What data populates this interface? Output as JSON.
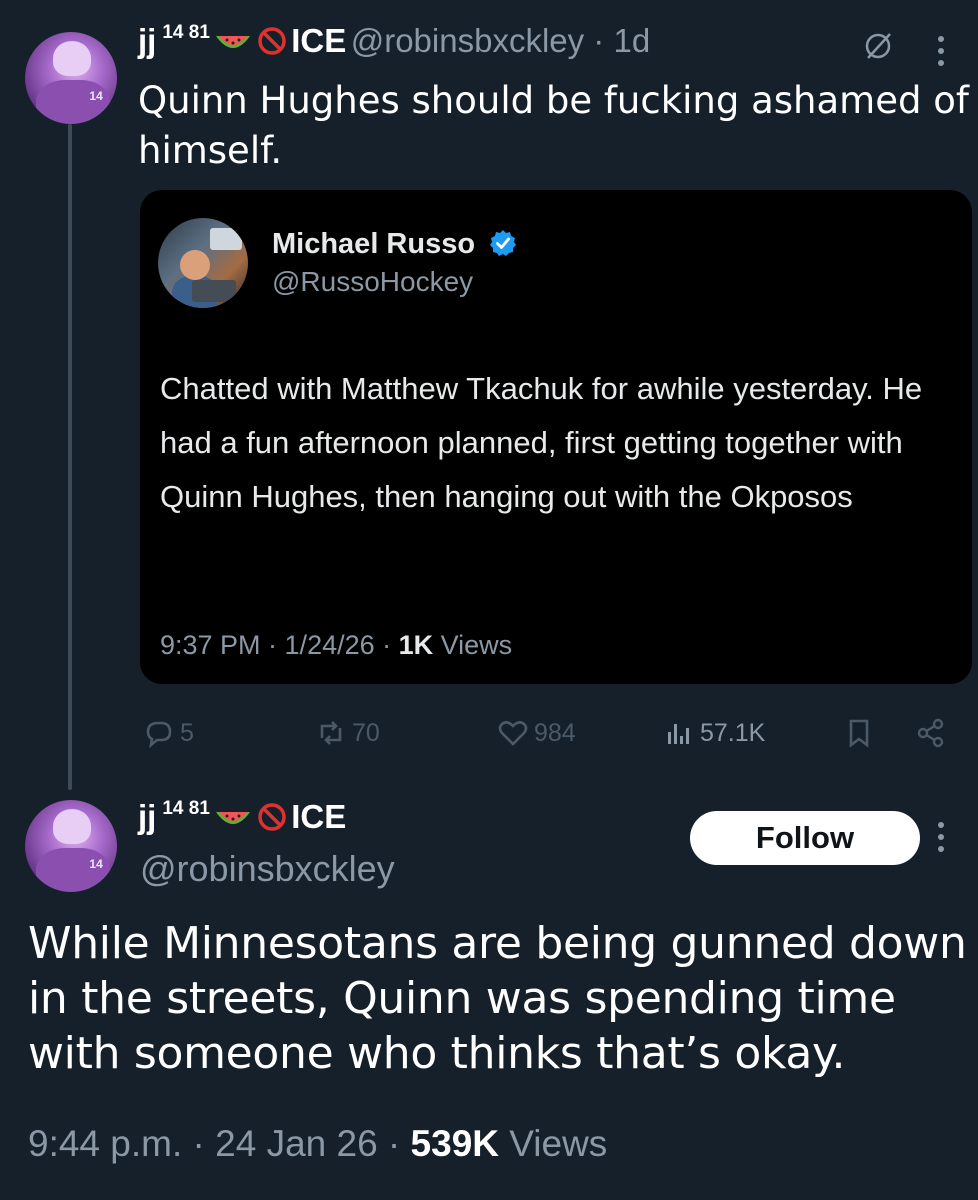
{
  "reply_tweet": {
    "display_name": "jj",
    "name_sup": "14 81",
    "ice_label": "ICE",
    "handle": "@robinsbxckley",
    "time": "1d",
    "text": "Quinn Hughes should be fucking ashamed of himself."
  },
  "quoted_tweet": {
    "name": "Michael Russo",
    "handle": "@RussoHockey",
    "text": "Chatted with Matthew Tkachuk for awhile yesterday. He had a fun afternoon planned, first getting together with Quinn Hughes, then hanging out with the Okposos",
    "time": "9:37 PM · 1/24/26 · ",
    "views_count": "1K",
    "views_label": " Views"
  },
  "actions": {
    "replies": "5",
    "retweets": "70",
    "likes": "984",
    "views": "57.1K"
  },
  "main_tweet": {
    "display_name": "jj",
    "name_sup": "14 81",
    "ice_label": "ICE",
    "handle": "@robinsbxckley",
    "follow_label": "Follow",
    "text": "While Minnesotans are being gunned down in the streets, Quinn was spending time with someone who thinks that’s okay.",
    "time": "9:44 p.m. · 24 Jan 26 · ",
    "views_count": "539K",
    "views_label": " Views"
  },
  "colors": {
    "background": "#15202b",
    "text_primary": "#ffffff",
    "text_secondary": "#8b98a5",
    "quote_background": "#000000",
    "verified_blue": "#1d9bf0"
  }
}
